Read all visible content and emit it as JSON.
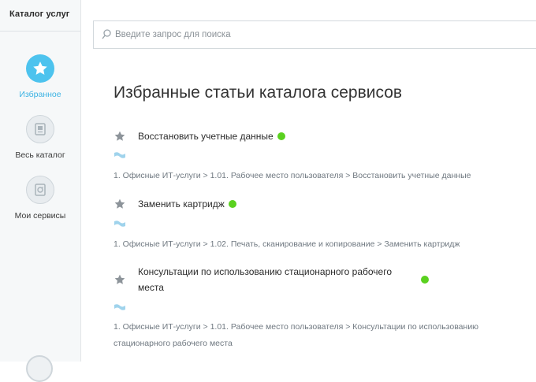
{
  "sidebar": {
    "title": "Каталог услуг",
    "items": [
      {
        "label": "Избранное",
        "active": true,
        "icon": "star-icon"
      },
      {
        "label": "Весь каталог",
        "active": false,
        "icon": "catalog-icon"
      },
      {
        "label": "Мои сервисы",
        "active": false,
        "icon": "my-services-icon"
      }
    ]
  },
  "search": {
    "placeholder": "Введите запрос для поиска",
    "value": ""
  },
  "main": {
    "title": "Избранные статьи каталога сервисов",
    "articles": [
      {
        "title": "Восстановить учетные данные",
        "breadcrumb": "1. Офисные ИТ-услуги > 1.01. Рабочее место пользователя > Восстановить учетные данные"
      },
      {
        "title": "Заменить картридж",
        "breadcrumb": "1. Офисные ИТ-услуги > 1.02. Печать, сканирование и копирование > Заменить картридж"
      },
      {
        "title": "Консультации по использованию стационарного рабочего места",
        "breadcrumb": "1. Офисные ИТ-услуги > 1.01. Рабочее место пользователя > Консультации по использованию стационарного рабочего места"
      }
    ]
  },
  "colors": {
    "accent": "#4dc3ee",
    "status_ok": "#5ad11f",
    "breadcrumb": "#6f7880"
  }
}
